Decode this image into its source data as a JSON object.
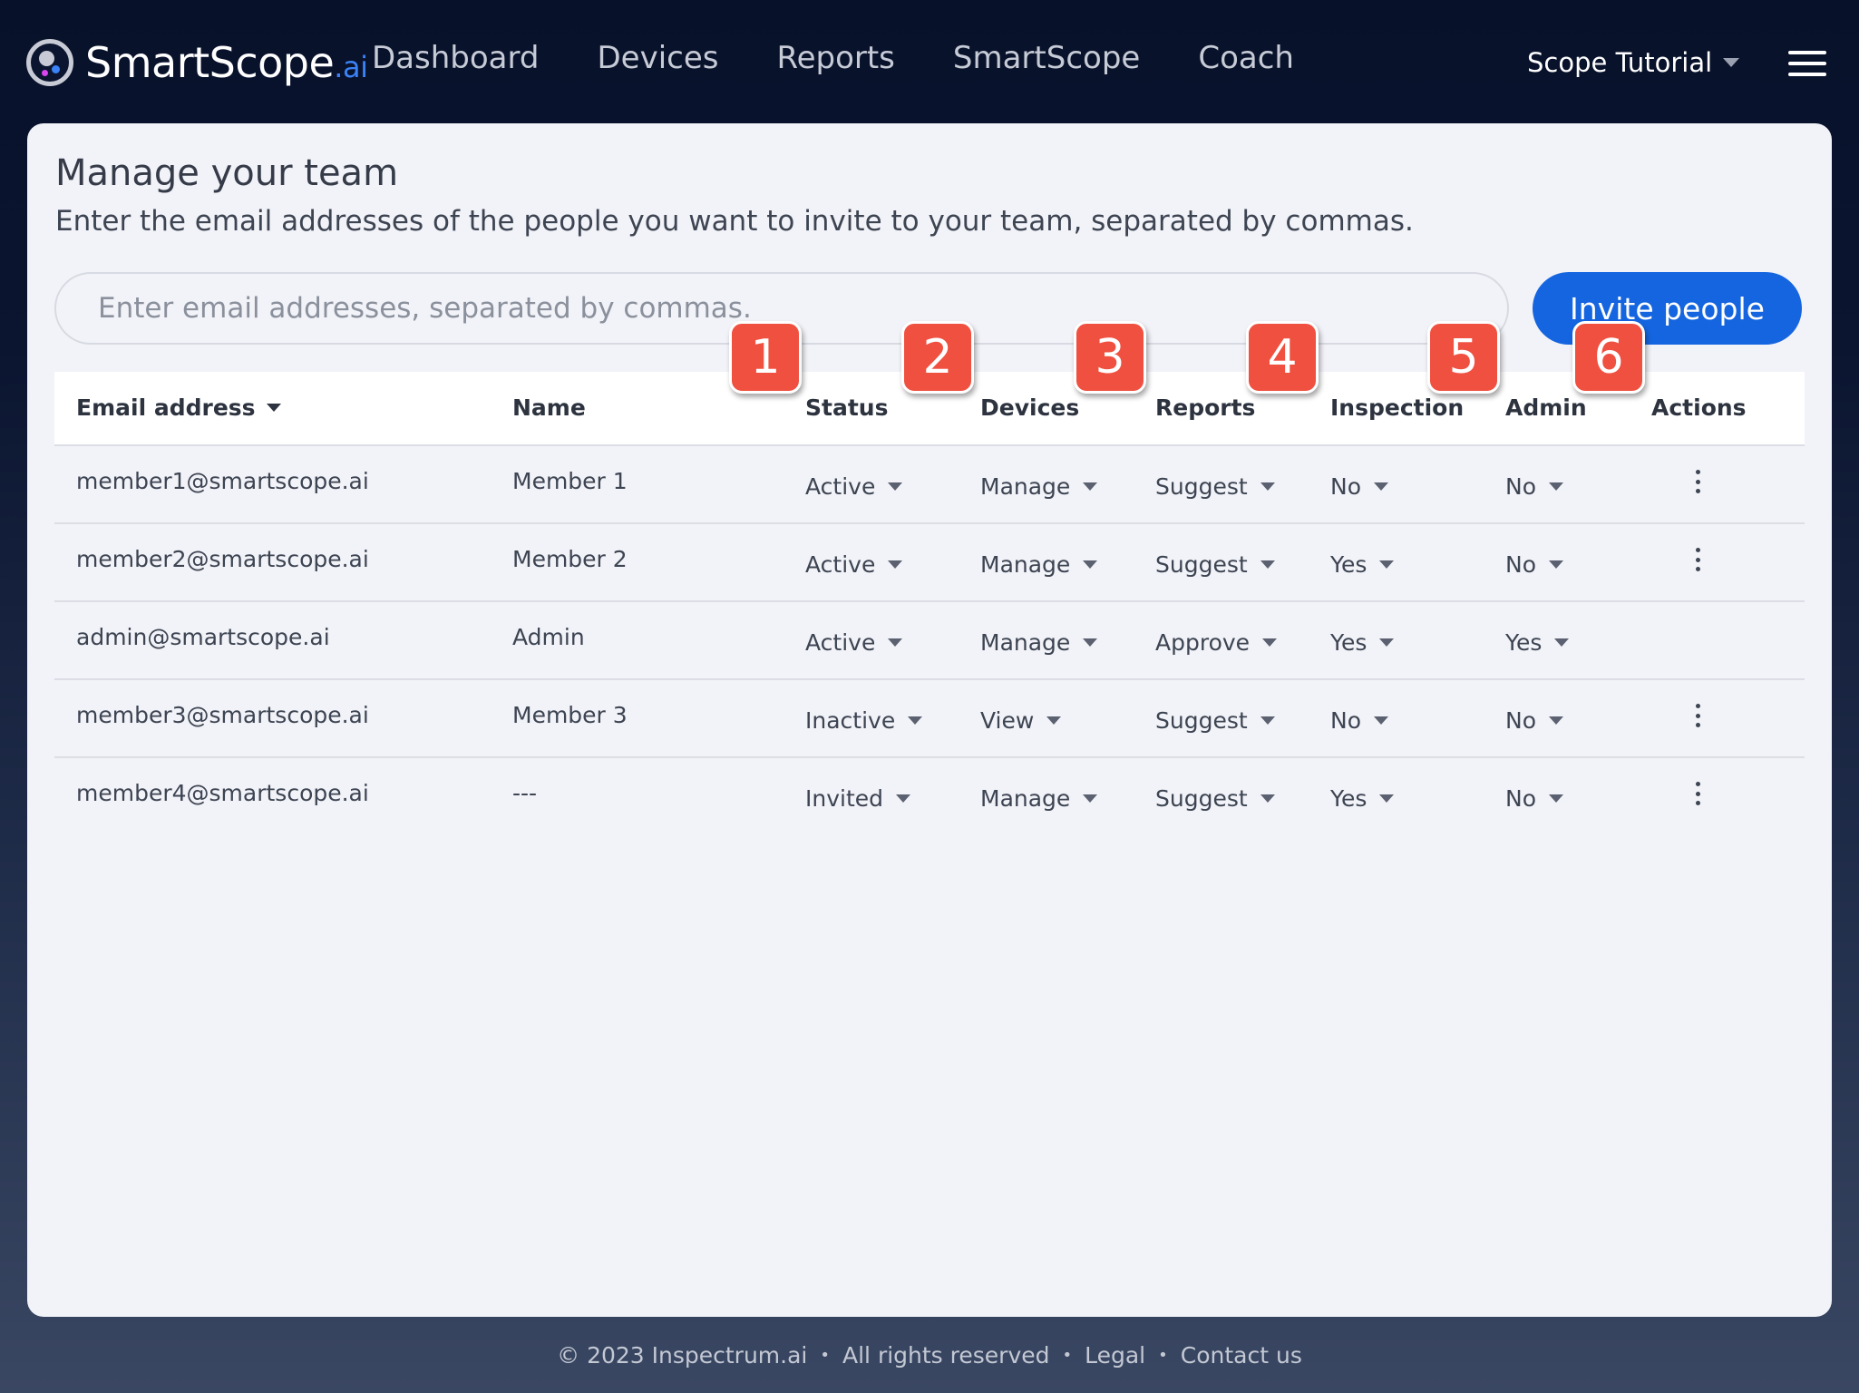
{
  "logo": {
    "text": "SmartScope",
    "suffix": ".ai"
  },
  "nav": {
    "items": [
      "Dashboard",
      "Devices",
      "Reports",
      "SmartScope",
      "Coach"
    ]
  },
  "user_menu": {
    "label": "Scope Tutorial"
  },
  "page": {
    "title": "Manage your team",
    "subtitle": "Enter the email addresses of the people you want to invite to your team, separated by commas.",
    "email_placeholder": "Enter email addresses, separated by commas.",
    "invite_label": "Invite people"
  },
  "table": {
    "columns": {
      "email": "Email address",
      "name": "Name",
      "status": "Status",
      "devices": "Devices",
      "reports": "Reports",
      "inspection": "Inspection",
      "admin": "Admin",
      "actions": "Actions"
    },
    "rows": [
      {
        "email": "member1@smartscope.ai",
        "name": "Member 1",
        "status": "Active",
        "devices": "Manage",
        "reports": "Suggest",
        "inspection": "No",
        "admin": "No",
        "has_actions": true
      },
      {
        "email": "member2@smartscope.ai",
        "name": "Member 2",
        "status": "Active",
        "devices": "Manage",
        "reports": "Suggest",
        "inspection": "Yes",
        "admin": "No",
        "has_actions": true
      },
      {
        "email": "admin@smartscope.ai",
        "name": "Admin",
        "status": "Active",
        "devices": "Manage",
        "reports": "Approve",
        "inspection": "Yes",
        "admin": "Yes",
        "has_actions": false
      },
      {
        "email": "member3@smartscope.ai",
        "name": "Member 3",
        "status": "Inactive",
        "devices": "View",
        "reports": "Suggest",
        "inspection": "No",
        "admin": "No",
        "has_actions": true
      },
      {
        "email": "member4@smartscope.ai",
        "name": "---",
        "status": "Invited",
        "devices": "Manage",
        "reports": "Suggest",
        "inspection": "Yes",
        "admin": "No",
        "has_actions": true
      }
    ]
  },
  "badges": [
    "1",
    "2",
    "3",
    "4",
    "5",
    "6"
  ],
  "footer": {
    "copyright": "© 2023 Inspectrum.ai",
    "rights": "All rights reserved",
    "legal": "Legal",
    "contact": "Contact us",
    "separator": "•"
  }
}
